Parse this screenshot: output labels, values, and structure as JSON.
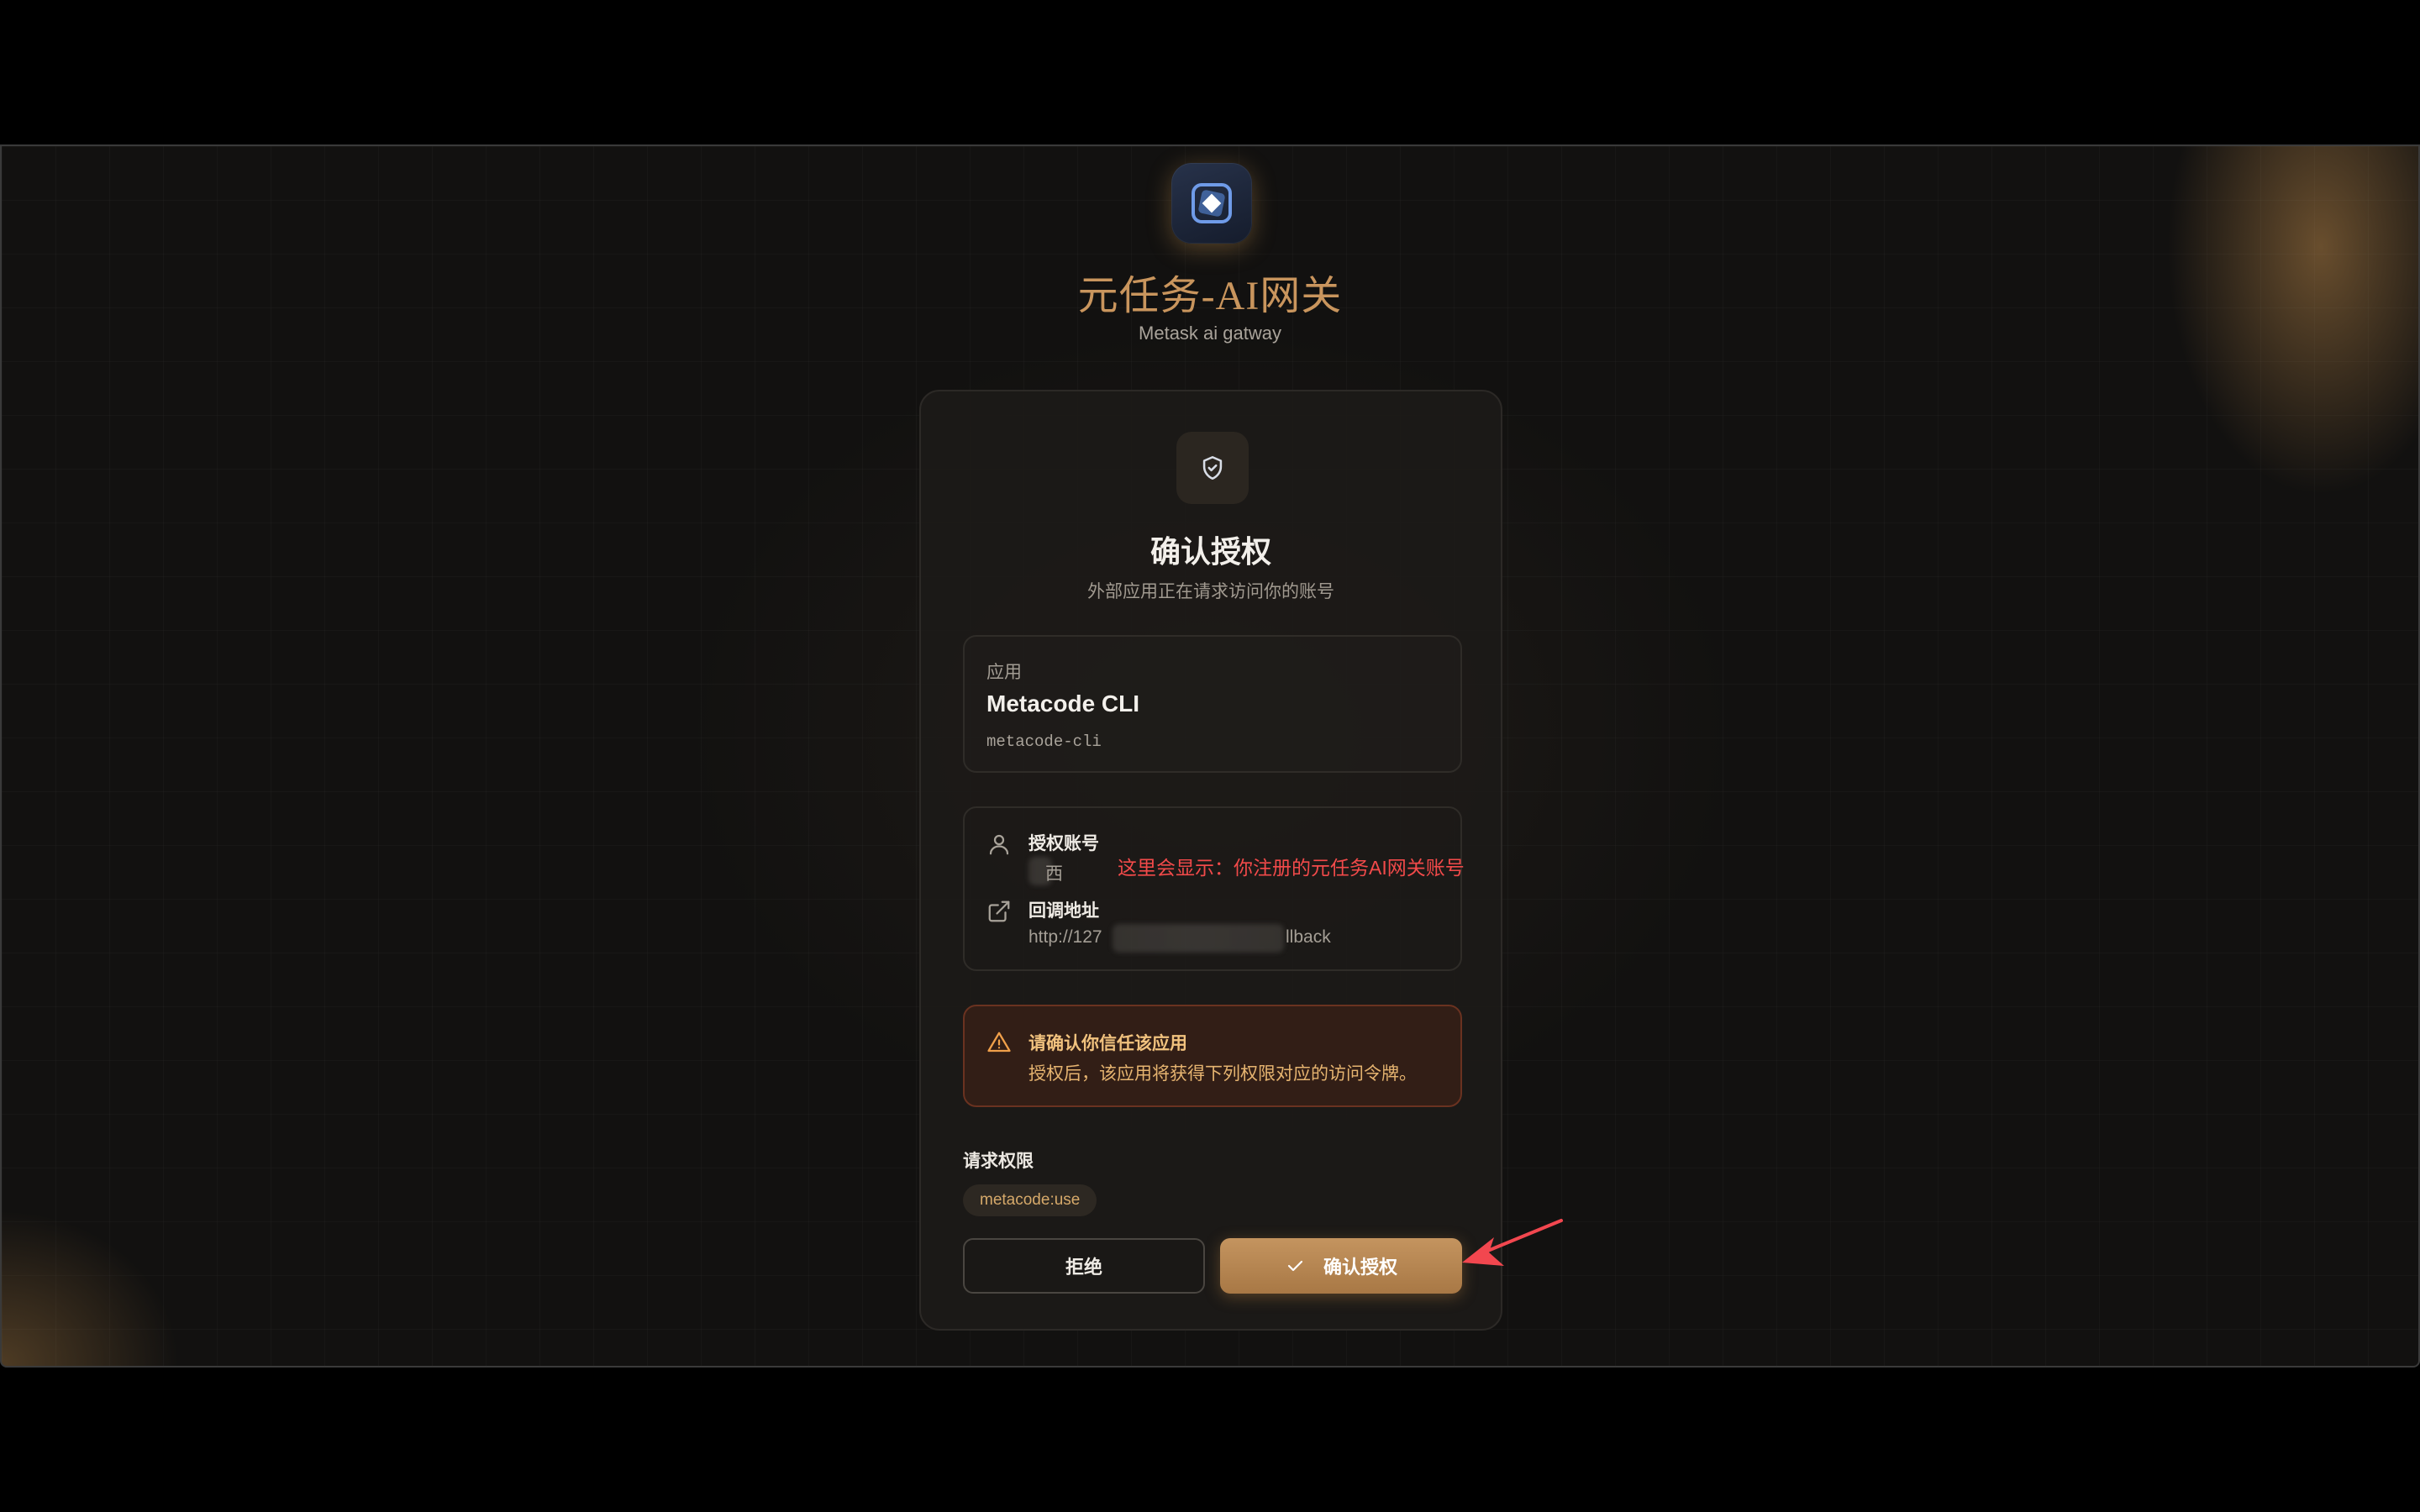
{
  "brand": {
    "title": "元任务-AI网关",
    "subtitle": "Metask ai gatway",
    "logo_icon": "diamond-cube-icon"
  },
  "card": {
    "icon": "shield-check-icon",
    "title": "确认授权",
    "subtitle": "外部应用正在请求访问你的账号",
    "app": {
      "label": "应用",
      "name": "Metacode CLI",
      "id": "metacode-cli"
    },
    "account": {
      "icon": "user-icon",
      "label": "授权账号",
      "value": "西"
    },
    "callback": {
      "icon": "external-link-icon",
      "label": "回调地址",
      "value_prefix": "http://127",
      "value_suffix": "llback"
    },
    "warning": {
      "icon": "warning-triangle-icon",
      "title": "请确认你信任该应用",
      "text": "授权后，该应用将获得下列权限对应的访问令牌。"
    },
    "permissions": {
      "label": "请求权限",
      "items": [
        "metacode:use"
      ]
    },
    "buttons": {
      "deny": "拒绝",
      "confirm": "确认授权",
      "confirm_icon": "check-icon"
    }
  },
  "annotation": {
    "text": "这里会显示：你注册的元任务AI网关账号",
    "color": "#f24a4a"
  },
  "colors": {
    "accent": "#c9955d",
    "warning_text": "#f1c27e",
    "background": "#121110"
  }
}
